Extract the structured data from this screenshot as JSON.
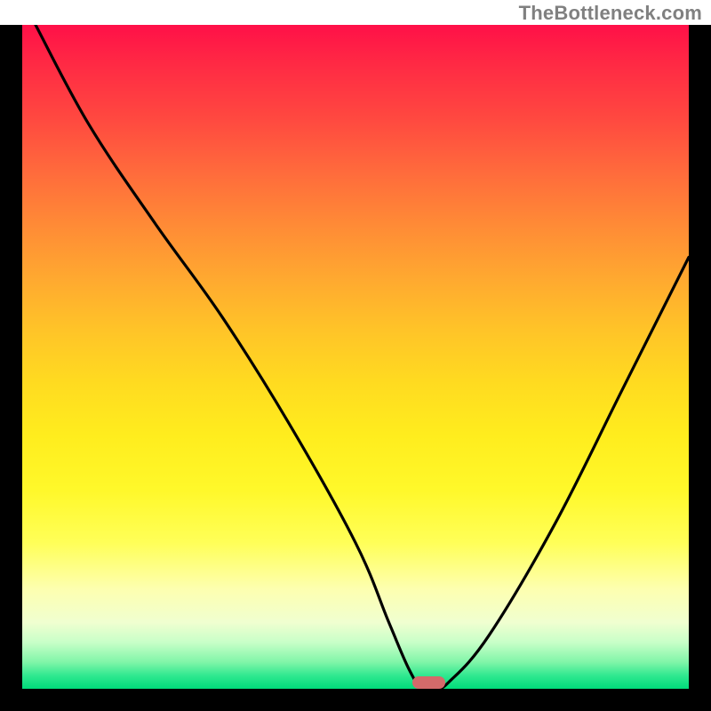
{
  "watermark": "TheBottleneck.com",
  "colors": {
    "frame": "#000000",
    "curve": "#000000",
    "sweet_spot": "#d46a6a",
    "watermark": "#808080"
  },
  "chart_data": {
    "type": "line",
    "title": "",
    "xlabel": "",
    "ylabel": "",
    "xlim": [
      0,
      100
    ],
    "ylim": [
      0,
      100
    ],
    "series": [
      {
        "name": "bottleneck-curve",
        "x": [
          2,
          10,
          20,
          30,
          40,
          50,
          55,
          58,
          60,
          62,
          64,
          70,
          80,
          90,
          100
        ],
        "values": [
          100,
          85,
          70,
          56,
          40,
          22,
          10,
          3,
          0,
          0,
          1,
          8,
          25,
          45,
          65
        ]
      }
    ],
    "sweet_spot": {
      "x": 61,
      "width": 5
    },
    "gradient_stops": [
      {
        "pos": 0,
        "color": "#ff1048"
      },
      {
        "pos": 50,
        "color": "#ffd020"
      },
      {
        "pos": 85,
        "color": "#fdffb0"
      },
      {
        "pos": 100,
        "color": "#00dc7a"
      }
    ]
  }
}
